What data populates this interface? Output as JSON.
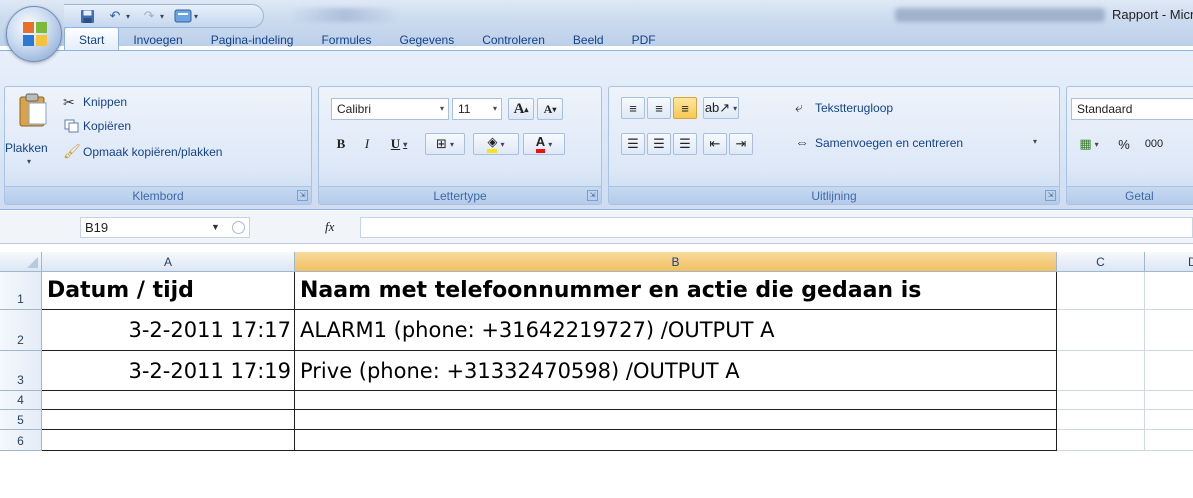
{
  "app": {
    "window_title": "Rapport - Micros"
  },
  "tabs": [
    "Start",
    "Invoegen",
    "Pagina-indeling",
    "Formules",
    "Gegevens",
    "Controleren",
    "Beeld",
    "PDF"
  ],
  "ribbon": {
    "clipboard": {
      "label": "Klembord",
      "paste": "Plakken",
      "cut": "Knippen",
      "copy": "Kopiëren",
      "format_painter": "Opmaak kopiëren/plakken"
    },
    "font": {
      "label": "Lettertype",
      "font_name": "Calibri",
      "font_size": "11",
      "bold": "B",
      "italic": "I",
      "underline": "U",
      "grow": "A",
      "shrink": "A"
    },
    "alignment": {
      "label": "Uitlijning",
      "wrap_text": "Tekstterugloop",
      "merge_center": "Samenvoegen en centreren"
    },
    "number": {
      "label": "Getal",
      "format": "Standaard",
      "percent": "%",
      "thousands": "000"
    }
  },
  "formula_bar": {
    "name_box": "B19",
    "fx": "fx",
    "content": ""
  },
  "sheet": {
    "columns": [
      "A",
      "B",
      "C",
      "D"
    ],
    "rows": [
      "1",
      "2",
      "3",
      "4",
      "5",
      "6"
    ],
    "cells": {
      "A1": "Datum / tijd",
      "B1": "Naam met telefoonnummer en actie die gedaan is",
      "A2": "3-2-2011 17:17",
      "B2": "ALARM1  (phone: +31642219727)  /OUTPUT A",
      "A3": "3-2-2011 17:19",
      "B3": "Prive  (phone: +31332470598)  /OUTPUT A"
    },
    "selected_column": "B",
    "accent_selected_header": "#f1c15f"
  }
}
